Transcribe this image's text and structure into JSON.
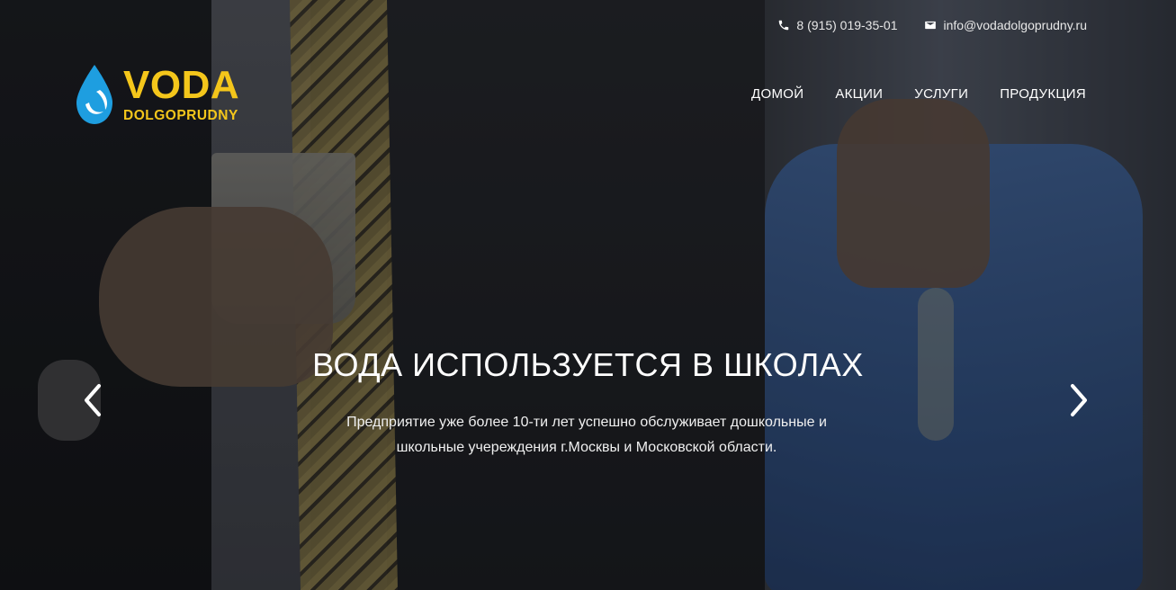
{
  "contacts": {
    "phone": "8 (915) 019-35-01",
    "email": "info@vodadolgoprudny.ru"
  },
  "logo": {
    "main": "VODA",
    "sub": "DOLGOPRUDNY"
  },
  "nav": {
    "items": [
      {
        "label": "ДОМОЙ"
      },
      {
        "label": "АКЦИИ"
      },
      {
        "label": "УСЛУГИ"
      },
      {
        "label": "ПРОДУКЦИЯ"
      }
    ]
  },
  "hero": {
    "title": "ВОДА ИСПОЛЬЗУЕТСЯ В ШКОЛАХ",
    "line1": "Предприятие уже более 10-ти лет успешно обслуживает дошкольные и",
    "line2": "школьные учереждения г.Москвы и Московской области."
  },
  "colors": {
    "brand_yellow": "#f4c61b",
    "brand_blue": "#1e9ee0"
  },
  "icons": {
    "phone": "phone-icon",
    "email": "envelope-icon",
    "prev": "chevron-left-icon",
    "next": "chevron-right-icon"
  }
}
